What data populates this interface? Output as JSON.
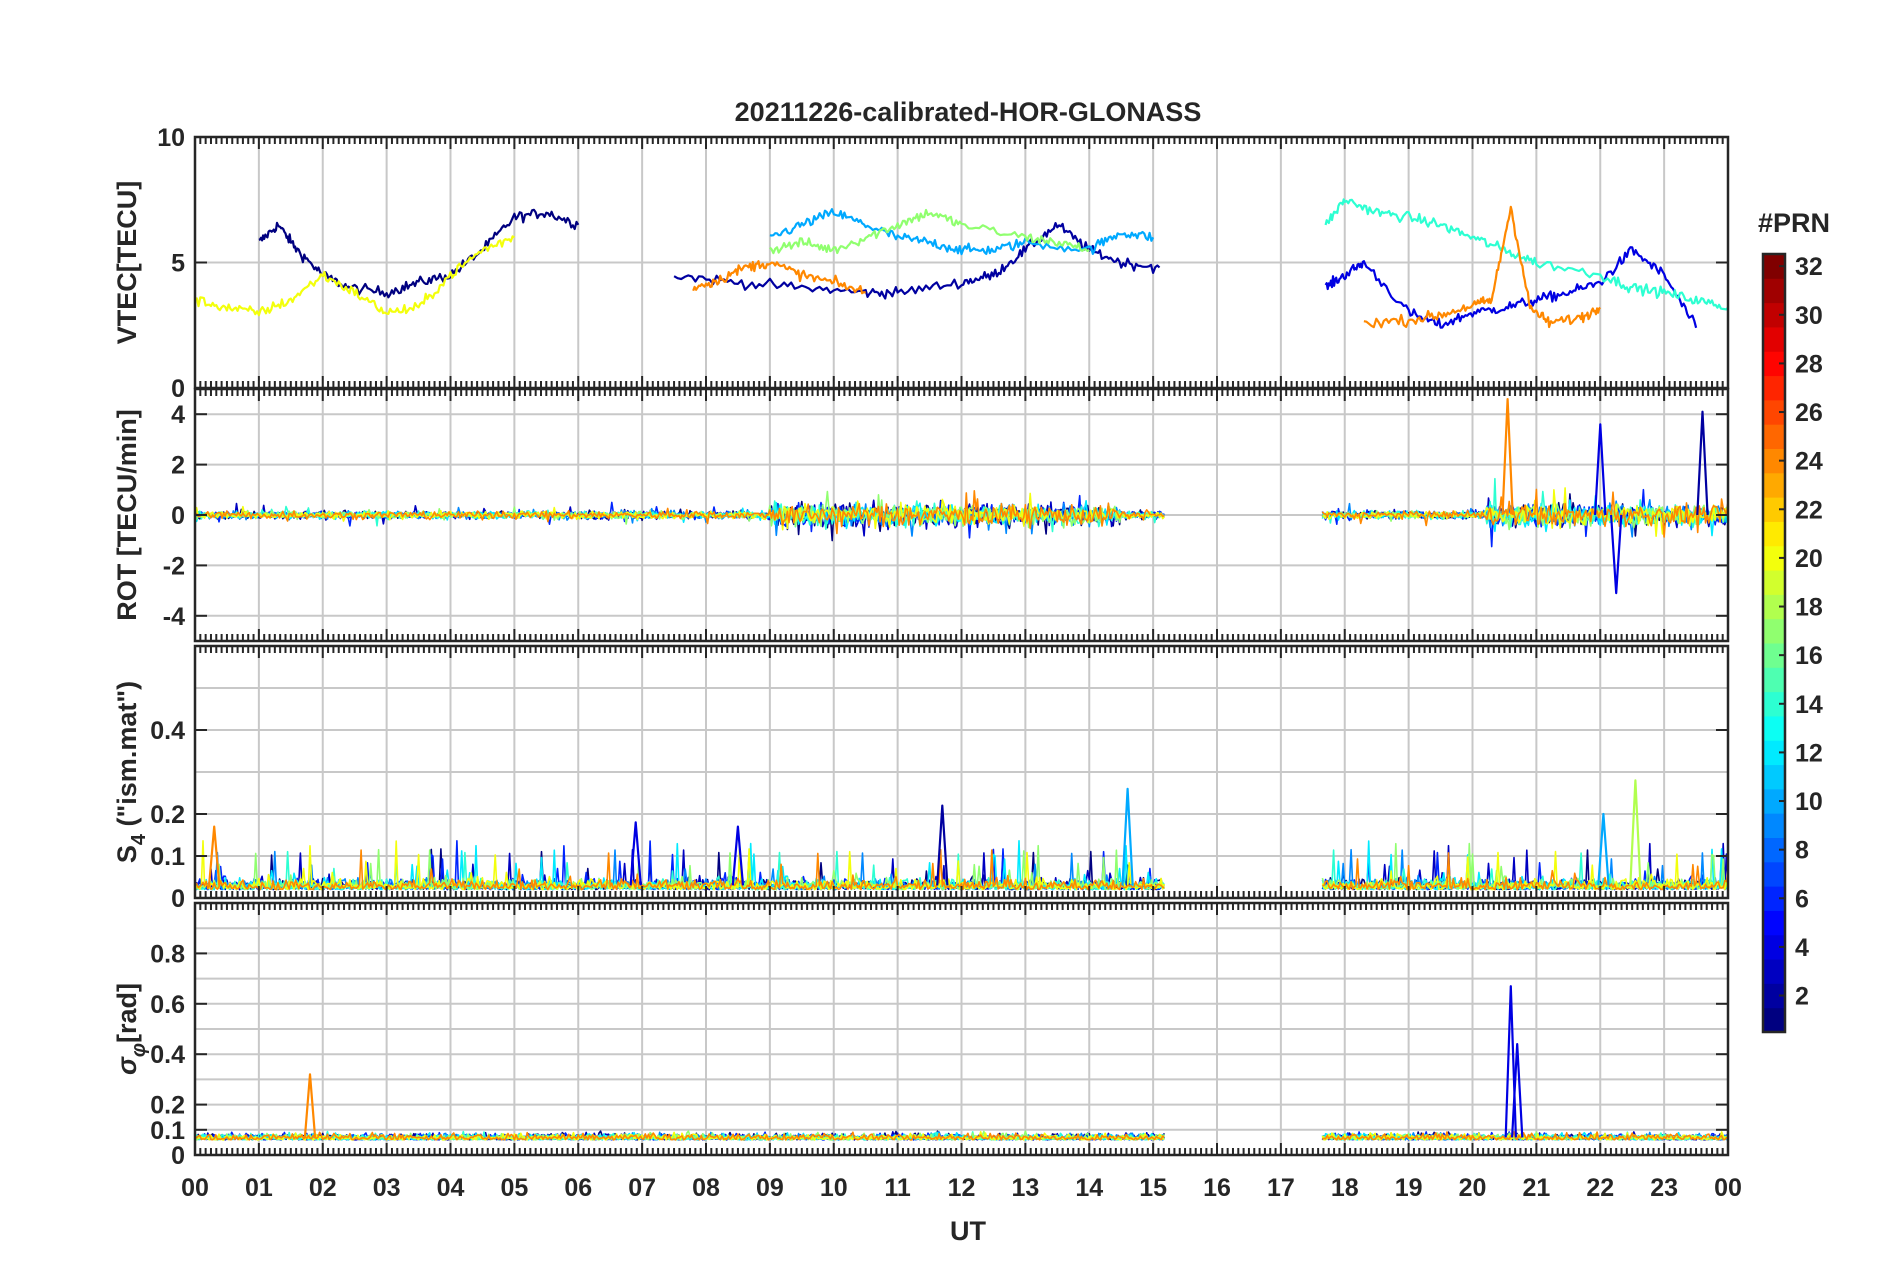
{
  "title": "20211226-calibrated-HOR-GLONASS",
  "chart_data": [
    {
      "type": "line",
      "panel": "vtec",
      "ylabel": "VTEC[TECU]",
      "ylim": [
        0,
        10
      ],
      "yticks": [
        "0",
        "5",
        "10"
      ],
      "grid": true,
      "xlim": [
        0,
        24
      ],
      "gap_hours": [
        15.2,
        17.65
      ],
      "series_summary": [
        {
          "prn": 1,
          "x": [
            1.0,
            1.3,
            1.6,
            2.0,
            2.4,
            3.0,
            3.5,
            4.0,
            4.5,
            5.0,
            5.5,
            6.0
          ],
          "y": [
            5.8,
            6.5,
            5.5,
            4.5,
            4.0,
            3.8,
            4.2,
            4.5,
            5.5,
            6.8,
            7.0,
            6.5
          ]
        },
        {
          "prn": 2,
          "x": [
            7.5,
            8.5,
            9.5,
            10.5,
            11.0,
            12.0,
            12.5,
            13.0,
            13.5,
            14.0,
            14.5,
            15.1
          ],
          "y": [
            4.5,
            4.2,
            4.0,
            3.8,
            3.8,
            4.2,
            4.5,
            5.5,
            6.5,
            5.5,
            5.0,
            4.8
          ]
        },
        {
          "prn": 4,
          "x": [
            17.7,
            18.0,
            18.3,
            19.0,
            19.5,
            20.0,
            20.5,
            21.0,
            21.5,
            22.0,
            22.5,
            23.0,
            23.5
          ],
          "y": [
            4.0,
            4.5,
            5.0,
            3.0,
            2.5,
            3.0,
            3.2,
            3.5,
            3.8,
            4.2,
            5.5,
            4.5,
            2.4
          ]
        },
        {
          "prn": 10,
          "x": [
            9.0,
            9.5,
            10.0,
            10.5,
            11.0,
            11.5,
            12.0,
            12.5,
            13.0,
            14.0,
            14.5,
            15.0
          ],
          "y": [
            6.0,
            6.5,
            7.0,
            6.5,
            6.0,
            5.8,
            5.5,
            5.5,
            5.8,
            5.5,
            6.2,
            6.0
          ]
        },
        {
          "prn": 14,
          "x": [
            17.7,
            18.0,
            18.5,
            19.0,
            19.5,
            20.0,
            20.5,
            21.0,
            22.0,
            22.5,
            23.0,
            23.5,
            24.0
          ],
          "y": [
            6.5,
            7.5,
            7.0,
            6.8,
            6.5,
            6.0,
            5.5,
            5.0,
            4.5,
            4.0,
            3.8,
            3.5,
            3.2
          ]
        },
        {
          "prn": 17,
          "x": [
            9.0,
            9.5,
            10.0,
            10.5,
            11.0,
            11.5,
            12.0,
            13.0,
            13.5,
            14.0
          ],
          "y": [
            5.5,
            5.8,
            5.5,
            6.0,
            6.5,
            7.0,
            6.5,
            6.0,
            5.8,
            5.5
          ]
        },
        {
          "prn": 20,
          "x": [
            0.0,
            0.5,
            1.0,
            1.5,
            2.0,
            2.5,
            3.0,
            3.5,
            4.0,
            4.5,
            5.0
          ],
          "y": [
            3.5,
            3.2,
            3.0,
            3.5,
            4.5,
            3.8,
            3.0,
            3.2,
            4.5,
            5.5,
            6.0
          ]
        },
        {
          "prn": 24,
          "x": [
            7.8,
            8.2,
            8.6,
            9.0,
            9.5,
            10.0,
            10.5
          ],
          "y": [
            4.0,
            4.3,
            4.8,
            5.0,
            4.5,
            4.2,
            3.8
          ]
        },
        {
          "prn": 24,
          "x": [
            18.3,
            19.0,
            19.5,
            20.0,
            20.3,
            20.6,
            20.9,
            21.2,
            21.7,
            22.0
          ],
          "y": [
            2.6,
            2.7,
            2.9,
            3.3,
            3.5,
            7.2,
            3.2,
            2.6,
            2.8,
            3.2
          ]
        }
      ]
    },
    {
      "type": "line",
      "panel": "rot",
      "ylabel": "ROT [TECU/min]",
      "ylim": [
        -5,
        5
      ],
      "yticks": [
        "-4",
        "-2",
        "0",
        "2",
        "4"
      ],
      "grid": true,
      "peaks": [
        {
          "x": 20.55,
          "y": 4.6
        },
        {
          "x": 22.0,
          "y": 3.6
        },
        {
          "x": 22.25,
          "y": -3.1
        },
        {
          "x": 23.6,
          "y": 4.1
        }
      ]
    },
    {
      "type": "line",
      "panel": "s4",
      "ylabel_main": "S",
      "ylabel_sub": "4",
      "ylabel_tail": " (\"ism.mat\")",
      "ylim": [
        0,
        0.6
      ],
      "yticks": [
        "0",
        "0.1",
        "0.2",
        "0.4"
      ],
      "grid": true,
      "peaks": [
        {
          "x": 0.3,
          "y": 0.17
        },
        {
          "x": 6.9,
          "y": 0.18
        },
        {
          "x": 8.5,
          "y": 0.17
        },
        {
          "x": 11.7,
          "y": 0.22
        },
        {
          "x": 14.6,
          "y": 0.26
        },
        {
          "x": 22.05,
          "y": 0.2
        },
        {
          "x": 22.55,
          "y": 0.28
        }
      ]
    },
    {
      "type": "line",
      "panel": "sigma_phi",
      "ylabel_main": "σ",
      "ylabel_sub": "φ",
      "ylabel_tail": "[rad]",
      "ylim": [
        0,
        1
      ],
      "yticks": [
        "0",
        "0.1",
        "0.2",
        "0.4",
        "0.6",
        "0.8"
      ],
      "grid": true,
      "peaks": [
        {
          "x": 1.8,
          "y": 0.32
        },
        {
          "x": 20.6,
          "y": 0.67
        },
        {
          "x": 20.7,
          "y": 0.44
        }
      ]
    }
  ],
  "xaxis": {
    "label": "UT",
    "ticks": [
      "00",
      "01",
      "02",
      "03",
      "04",
      "05",
      "06",
      "07",
      "08",
      "09",
      "10",
      "11",
      "12",
      "13",
      "14",
      "15",
      "16",
      "17",
      "18",
      "19",
      "20",
      "21",
      "22",
      "23",
      "00"
    ]
  },
  "colorbar": {
    "label": "#PRN",
    "range": [
      1,
      32
    ],
    "ticks": [
      "2",
      "4",
      "6",
      "8",
      "10",
      "12",
      "14",
      "16",
      "18",
      "20",
      "22",
      "24",
      "26",
      "28",
      "30",
      "32"
    ],
    "colormap": "jet"
  }
}
